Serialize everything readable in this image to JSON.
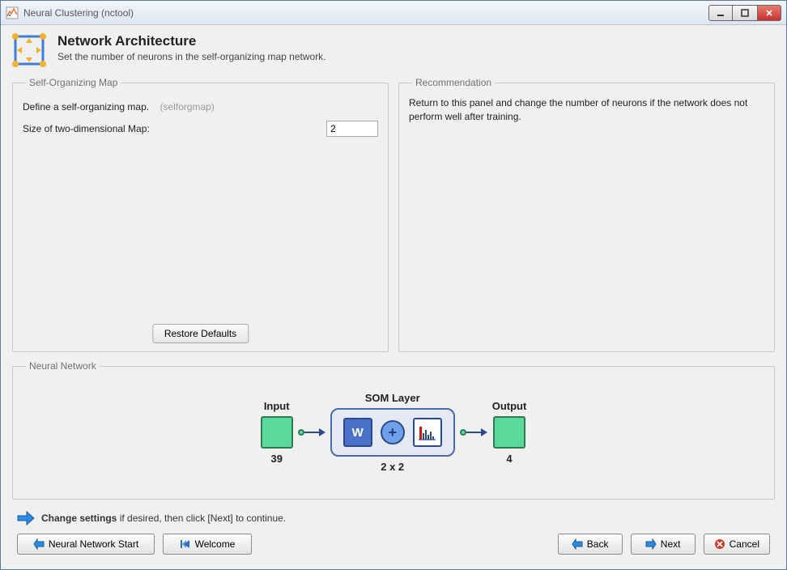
{
  "window": {
    "title": "Neural Clustering (nctool)"
  },
  "header": {
    "title": "Network Architecture",
    "subtitle": "Set the number of neurons in the self-organizing map network."
  },
  "som_panel": {
    "legend": "Self-Organizing Map",
    "define_text": "Define a self-organizing map.",
    "define_hint": "(selforgmap)",
    "size_label": "Size of two-dimensional Map:",
    "size_value": "2",
    "restore_label": "Restore Defaults"
  },
  "rec_panel": {
    "legend": "Recommendation",
    "text": "Return to this panel and change the number of neurons if the network does not perform well after training."
  },
  "nn_panel": {
    "legend": "Neural Network",
    "input_label": "Input",
    "input_size": "39",
    "som_label": "SOM Layer",
    "som_size": "2 x 2",
    "w_label": "W",
    "plus_label": "+",
    "output_label": "Output",
    "output_size": "4"
  },
  "hint": {
    "text_prefix": "Change settings",
    "text_suffix": " if desired, then click [Next] to continue."
  },
  "footer": {
    "nnstart": "Neural Network Start",
    "welcome": "Welcome",
    "back": "Back",
    "next": "Next",
    "cancel": "Cancel"
  }
}
